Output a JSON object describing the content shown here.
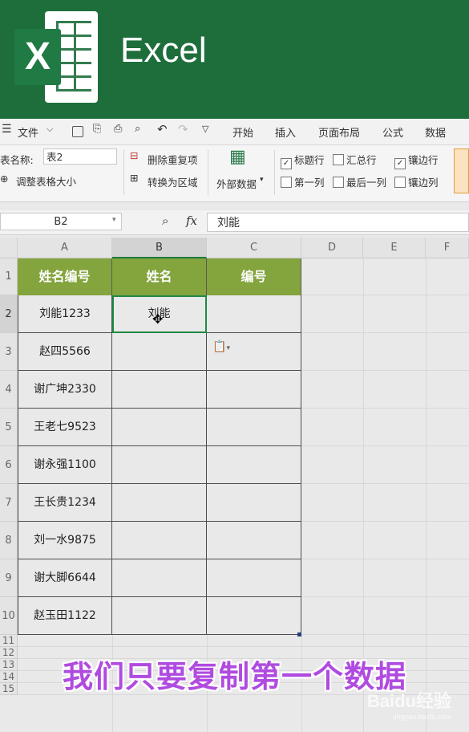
{
  "app": {
    "title": "Excel"
  },
  "menu": {
    "file": "文件",
    "tabs": [
      "开始",
      "插入",
      "页面布局",
      "公式",
      "数据"
    ]
  },
  "ribbon": {
    "table_name_label": "表名称:",
    "table_name_value": "表2",
    "resize_table": "调整表格大小",
    "remove_duplicates": "删除重复项",
    "convert_to_range": "转换为区域",
    "external_data": "外部数据",
    "header_row": "标题行",
    "total_row": "汇总行",
    "banded_rows": "镶边行",
    "first_column": "第一列",
    "last_column": "最后一列",
    "banded_columns": "镶边列"
  },
  "formula_bar": {
    "cell_ref": "B2",
    "fx": "fx",
    "value": "刘能"
  },
  "sheet": {
    "columns": [
      "A",
      "B",
      "C",
      "D",
      "E",
      "F"
    ],
    "rows": [
      "1",
      "2",
      "3",
      "4",
      "5",
      "6",
      "7",
      "8",
      "9",
      "10",
      "11",
      "12",
      "13",
      "14",
      "15"
    ],
    "headers": [
      "姓名编号",
      "姓名",
      "编号"
    ],
    "col_a": [
      "刘能1233",
      "赵四5566",
      "谢广坤2330",
      "王老七9523",
      "谢永强1100",
      "王长贵1234",
      "刘一水9875",
      "谢大脚6644",
      "赵玉田1122"
    ],
    "col_b": [
      "刘能",
      "",
      "",
      "",
      "",
      "",
      "",
      "",
      ""
    ],
    "col_c": [
      "",
      "",
      "",
      "",
      "",
      "",
      "",
      "",
      ""
    ]
  },
  "caption": "我们只要复制第一个数据",
  "watermark": {
    "brand": "Baidu经验",
    "url": "jingyan.baidu.com"
  },
  "colors": {
    "banner": "#1e6e3c",
    "table_header": "#84a43e",
    "caption": "#b04be0"
  }
}
